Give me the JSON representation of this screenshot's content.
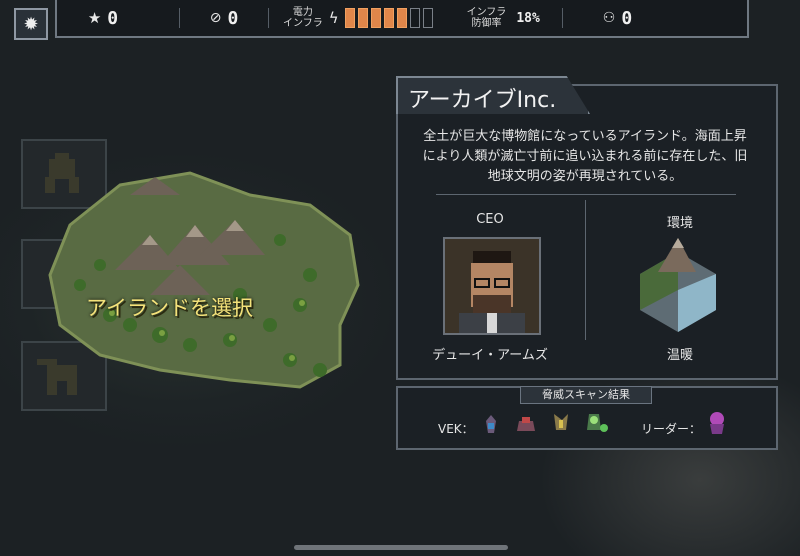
{
  "top_bar": {
    "stars": "0",
    "reputation": "0",
    "power_label_1": "電力",
    "power_label_2": "インフラ",
    "power_filled": 5,
    "power_total": 7,
    "defense_label_1": "インフラ",
    "defense_label_2": "防御率",
    "defense_value": "18%",
    "pilots": "0"
  },
  "island": {
    "label": "アイランドを選択"
  },
  "corp_panel": {
    "title": "アーカイブInc.",
    "description": "全土が巨大な博物館になっているアイランド。海面上昇により人類が滅亡寸前に追い込まれる前に存在した、旧地球文明の姿が再現されている。",
    "ceo_label": "CEO",
    "ceo_name": "デューイ・アームズ",
    "env_label": "環境",
    "env_name": "温暖"
  },
  "threat_scan": {
    "header": "脅威スキャン結果",
    "vek_label": "VEK：",
    "leader_label": "リーダー：",
    "vek_icons": [
      "vek-scorpion-icon",
      "vek-crab-icon",
      "vek-hornet-icon",
      "vek-firefly-icon"
    ],
    "leader_icon": "vek-leader-icon"
  },
  "colors": {
    "power_on": "#e0864a",
    "island_label": "#f4e27a",
    "panel_bg": "#1b2025"
  }
}
